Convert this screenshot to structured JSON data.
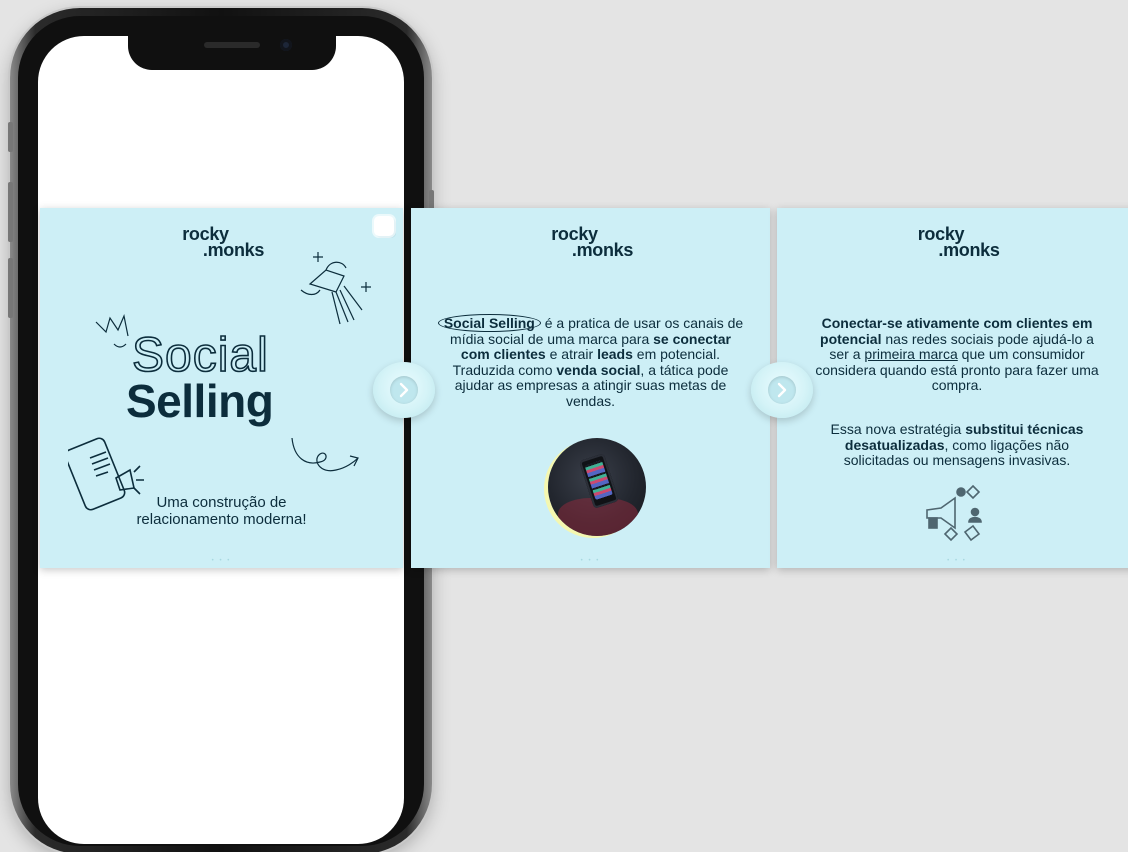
{
  "brand": {
    "logo_line1": "rocky",
    "logo_line2": ".monks"
  },
  "slides": [
    {
      "title_outline": "Social",
      "title_bold": "Selling",
      "tagline_line1": "Uma construção de",
      "tagline_line2": "relacionamento moderna!"
    },
    {
      "text": {
        "circled": "Social Selling",
        "p1": " é a pratica de usar os canais de mídia social de uma marca para ",
        "b1": "se conectar com clientes",
        "p2": " e atrair ",
        "b2": "leads",
        "p3": " em potencial. Traduzida como ",
        "b3": "venda social",
        "p4": ", a tática pode ajudar as empresas a atingir suas metas de vendas."
      }
    },
    {
      "para1": {
        "b1": "Conectar-se ativamente com clientes em potencial",
        "p1": " nas redes sociais pode ajudá-lo a ser a ",
        "u1": "primeira marca",
        "p2": " que um consumidor considera quando está pronto para fazer uma compra."
      },
      "para2": {
        "p1": "Essa nova estratégia ",
        "b1": "substitui técnicas desatualizadas",
        "p2": ", como ligações não solicitadas ou mensagens invasivas."
      }
    }
  ],
  "icons": {
    "next_arrow": "chevron-right-icon",
    "multi": "multiple-posts-icon"
  },
  "colors": {
    "slide_bg": "#cdeff6",
    "ink": "#0c2d3c",
    "page_bg": "#e4e4e4"
  }
}
